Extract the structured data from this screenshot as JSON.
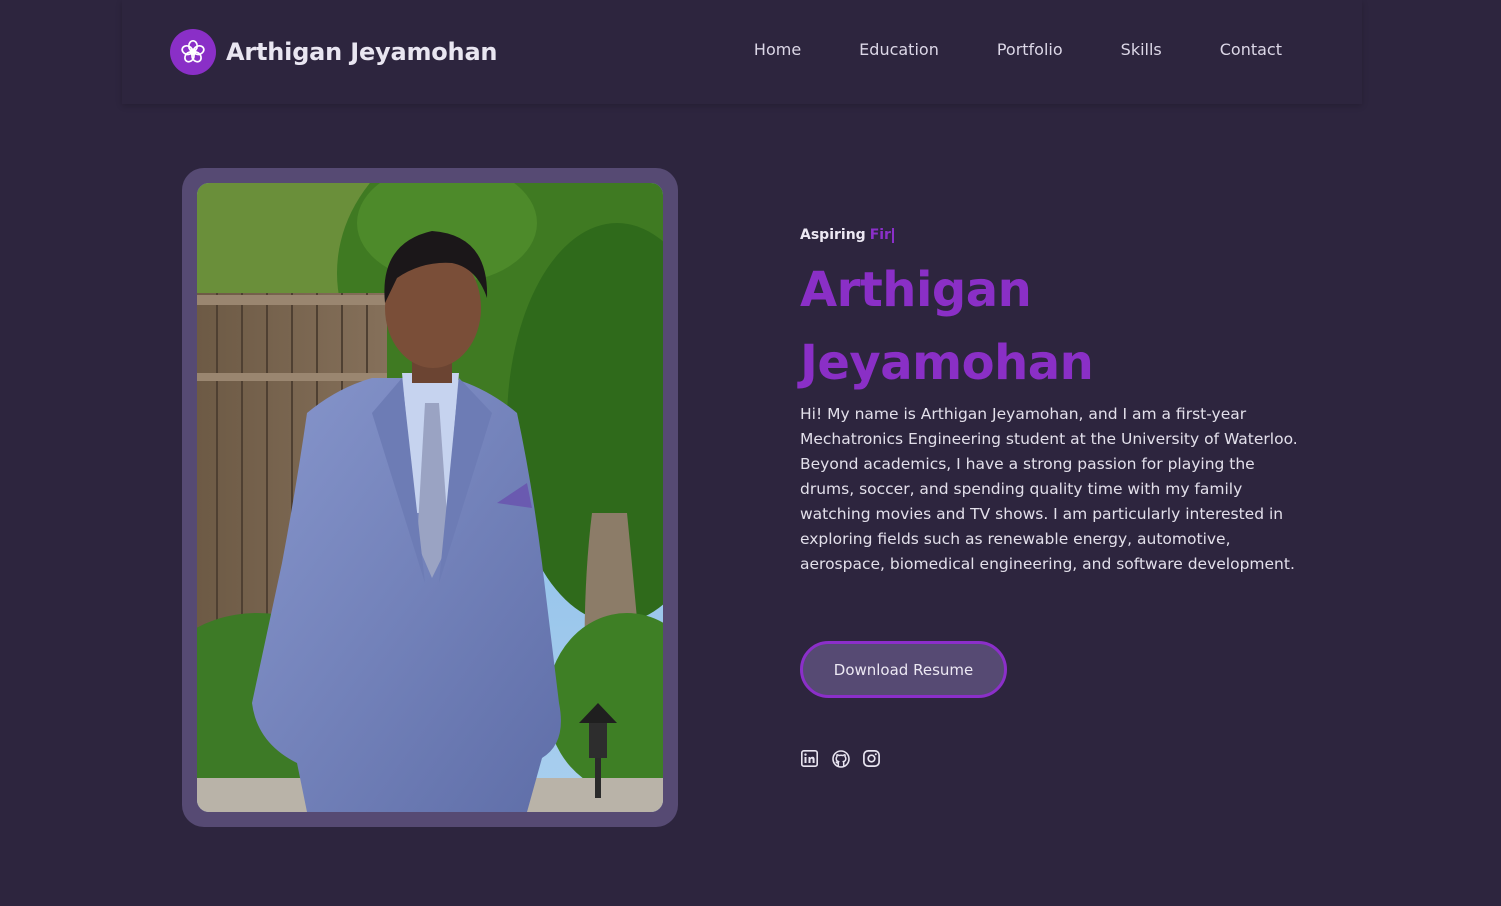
{
  "brand": {
    "name": "Arthigan Jeyamohan",
    "logo_icon": "flower-icon",
    "logo_color": "#8a2fc7"
  },
  "nav": {
    "items": [
      {
        "label": "Home"
      },
      {
        "label": "Education"
      },
      {
        "label": "Portfolio"
      },
      {
        "label": "Skills"
      },
      {
        "label": "Contact"
      }
    ]
  },
  "hero": {
    "eyebrow_static": "Aspiring",
    "eyebrow_typed": "Fir",
    "name_line1": "Arthigan",
    "name_line2": "Jeyamohan",
    "bio": "Hi! My name is Arthigan Jeyamohan, and I am a first-year Mechatronics Engineering student at the University of Waterloo. Beyond academics, I have a strong passion for playing the drums, soccer, and spending quality time with my family watching movies and TV shows. I am particularly interested in exploring fields such as renewable energy, automotive, aerospace, biomedical engineering, and software development.",
    "resume_button": "Download Resume",
    "socials": [
      {
        "icon": "linkedin-icon"
      },
      {
        "icon": "github-icon"
      },
      {
        "icon": "instagram-icon"
      }
    ]
  },
  "colors": {
    "background": "#2d253e",
    "accent": "#8a2fc6",
    "frame": "#564a73"
  }
}
